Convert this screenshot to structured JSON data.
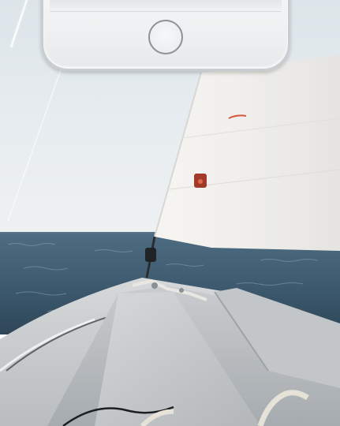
{
  "scene": {
    "subject": "sailboat-bow-on-open-sea",
    "sky_color": "#dfe6ea",
    "sea_color": "#3f5d72",
    "sail_color": "#f2f1ee",
    "hull_color": "#cfd2d4"
  },
  "device": {
    "type": "smartphone-bottom-bezel",
    "home_button_icon": "home-button-icon",
    "frame_color": "#f1f2f3"
  }
}
